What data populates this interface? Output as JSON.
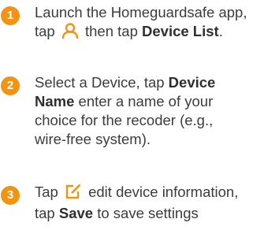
{
  "steps": [
    {
      "number": "1",
      "line1": "Launch the Homeguardsafe app,",
      "line2_pre": "tap",
      "line2_icon": "user-icon",
      "line2_mid": "then tap",
      "line2_bold": "Device List",
      "line2_post": "."
    },
    {
      "number": "2",
      "line1_pre": "Select a Device, tap",
      "line1_bold": "Device",
      "line2_bold": "Name",
      "line2_post": "enter a name of your",
      "line3": "choice for the recoder (e.g.,",
      "line4": "wire-free system)."
    },
    {
      "number": "3",
      "line1_pre": "Tap",
      "line1_icon": "edit-icon",
      "line1_post": "edit device information,",
      "line2_pre": "tap",
      "line2_bold": "Save",
      "line2_post": "to save settings"
    }
  ],
  "colors": {
    "accent": "#f29312",
    "text": "#3c3c3c"
  }
}
